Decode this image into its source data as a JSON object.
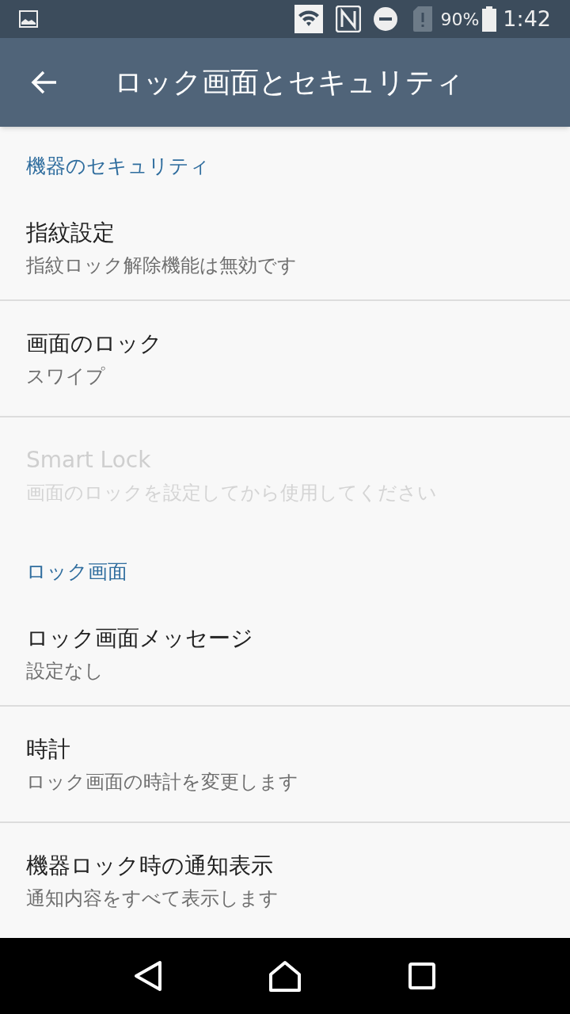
{
  "status_bar": {
    "battery": "90%",
    "time": "1:42"
  },
  "app_bar": {
    "title": "ロック画面とセキュリティ"
  },
  "sections": [
    {
      "header": "機器のセキュリティ",
      "items": [
        {
          "title": "指紋設定",
          "summary": "指紋ロック解除機能は無効です",
          "disabled": false
        },
        {
          "title": "画面のロック",
          "summary": "スワイプ",
          "disabled": false
        },
        {
          "title": "Smart Lock",
          "summary": "画面のロックを設定してから使用してください",
          "disabled": true
        }
      ]
    },
    {
      "header": "ロック画面",
      "items": [
        {
          "title": "ロック画面メッセージ",
          "summary": "設定なし",
          "disabled": false
        },
        {
          "title": "時計",
          "summary": "ロック画面の時計を変更します",
          "disabled": false
        },
        {
          "title": "機器ロック時の通知表示",
          "summary": "通知内容をすべて表示します",
          "disabled": false
        }
      ]
    }
  ]
}
